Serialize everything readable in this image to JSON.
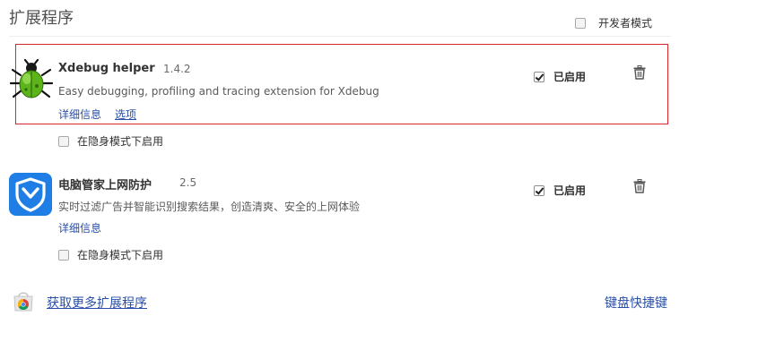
{
  "page": {
    "title": "扩展程序",
    "developer_mode_label": "开发者模式",
    "developer_mode_checked": false
  },
  "extensions": [
    {
      "name": "Xdebug helper",
      "version": "1.4.2",
      "description": "Easy debugging, profiling and tracing extension for Xdebug",
      "details_link": "详细信息",
      "options_link": "选项",
      "enabled_label": "已启用",
      "enabled": true,
      "incognito_label": "在隐身模式下启用",
      "incognito_enabled": false,
      "icon": "bug-icon",
      "highlighted": true
    },
    {
      "name": "电脑管家上网防护",
      "version": "2.5",
      "description": "实时过滤广告并智能识别搜索结果，创造清爽、安全的上网体验",
      "details_link": "详细信息",
      "enabled_label": "已启用",
      "enabled": true,
      "incognito_label": "在隐身模式下启用",
      "incognito_enabled": false,
      "icon": "shield-icon"
    }
  ],
  "footer": {
    "store_link": "获取更多扩展程序",
    "keyboard_shortcuts_link": "键盘快捷键"
  },
  "colors": {
    "link": "#2a4fa8",
    "highlight_border": "#d9272e",
    "shield_blue": "#1e7ee6",
    "bug_green": "#6bbf1f"
  }
}
